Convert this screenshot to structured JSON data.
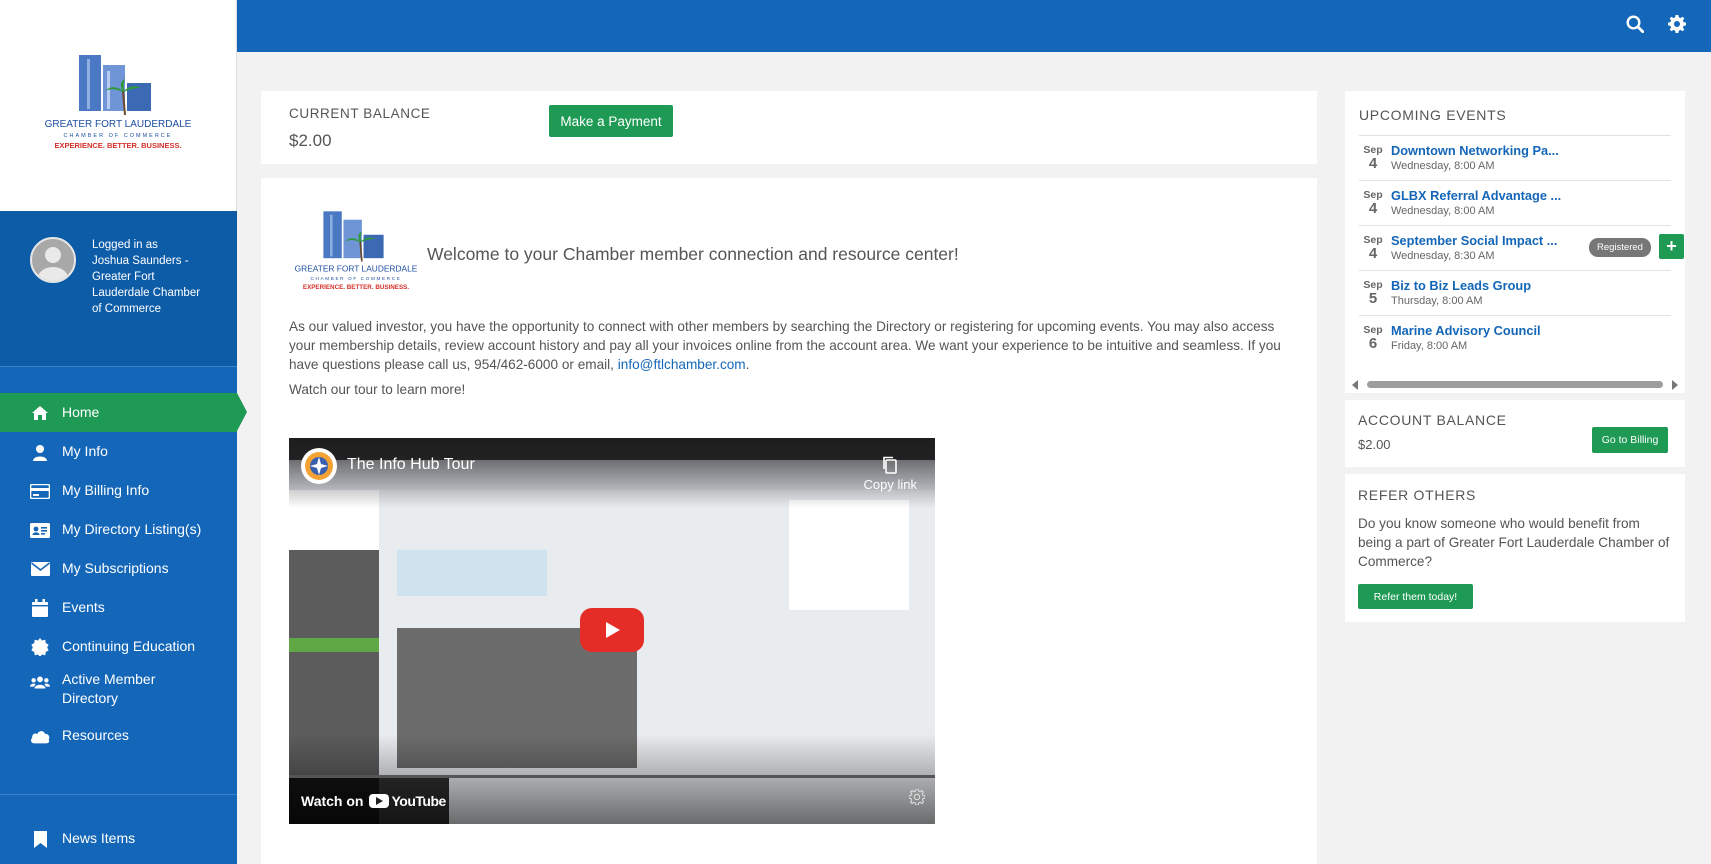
{
  "sidebar": {
    "user": {
      "logged_in_as": "Logged in as",
      "name_org": "Joshua Saunders - Greater Fort Lauderdale Chamber of Commerce"
    },
    "items": [
      {
        "label": "Home",
        "icon": "home-icon"
      },
      {
        "label": "My Info",
        "icon": "user-icon"
      },
      {
        "label": "My Billing Info",
        "icon": "credit-card-icon"
      },
      {
        "label": "My Directory Listing(s)",
        "icon": "id-card-icon"
      },
      {
        "label": "My Subscriptions",
        "icon": "envelope-icon"
      },
      {
        "label": "Events",
        "icon": "calendar-icon"
      },
      {
        "label": "Continuing Education",
        "icon": "certificate-icon"
      },
      {
        "label": "Active Member Directory",
        "icon": "users-icon"
      },
      {
        "label": "Resources",
        "icon": "cloud-icon"
      }
    ],
    "bottom_item": {
      "label": "News Items",
      "icon": "bookmark-icon"
    }
  },
  "logo": {
    "line1": "GREATER FORT LAUDERDALE",
    "line2": "CHAMBER OF COMMERCE",
    "tagline": "EXPERIENCE. BETTER. BUSINESS."
  },
  "balance": {
    "label": "CURRENT BALANCE",
    "amount": "$2.00",
    "pay_button": "Make a Payment"
  },
  "welcome": {
    "title": "Welcome to your Chamber member connection and resource center!",
    "paragraph": "As our valued investor, you have the opportunity to connect with other members by searching the Directory or registering for upcoming events. You may also access your membership details, review account history and pay all your invoices online from the account area.  We want your experience to be intuitive and seamless.  If you have questions please call us, 954/462-6000 or email, ",
    "email": "info@ftlchamber.com",
    "period": ".",
    "tour_text": "Watch our tour to learn more!"
  },
  "video": {
    "title": "The Info Hub Tour",
    "copy_link": "Copy link",
    "watch_on": "Watch on",
    "youtube": "YouTube"
  },
  "events": {
    "title": "UPCOMING EVENTS",
    "items": [
      {
        "month": "Sep",
        "day": "4",
        "title": "Downtown Networking Pa...",
        "time": "Wednesday, 8:00 AM"
      },
      {
        "month": "Sep",
        "day": "4",
        "title": "GLBX Referral Advantage ...",
        "time": "Wednesday, 8:00 AM"
      },
      {
        "month": "Sep",
        "day": "4",
        "title": "September Social Impact ...",
        "time": "Wednesday, 8:30 AM",
        "badge": "Registered"
      },
      {
        "month": "Sep",
        "day": "5",
        "title": "Biz to Biz Leads Group",
        "time": "Thursday, 8:00 AM"
      },
      {
        "month": "Sep",
        "day": "6",
        "title": "Marine Advisory Council",
        "time": "Friday, 8:00 AM"
      }
    ],
    "add_label": "+"
  },
  "account": {
    "title": "ACCOUNT BALANCE",
    "amount": "$2.00",
    "button": "Go to Billing"
  },
  "refer": {
    "title": "REFER OTHERS",
    "text": "Do you know someone who would benefit from being a part of Greater Fort Lauderdale Chamber of Commerce?",
    "button": "Refer them today!"
  },
  "colors": {
    "brand_blue": "#1467b8",
    "accent_green": "#1e9a55"
  }
}
